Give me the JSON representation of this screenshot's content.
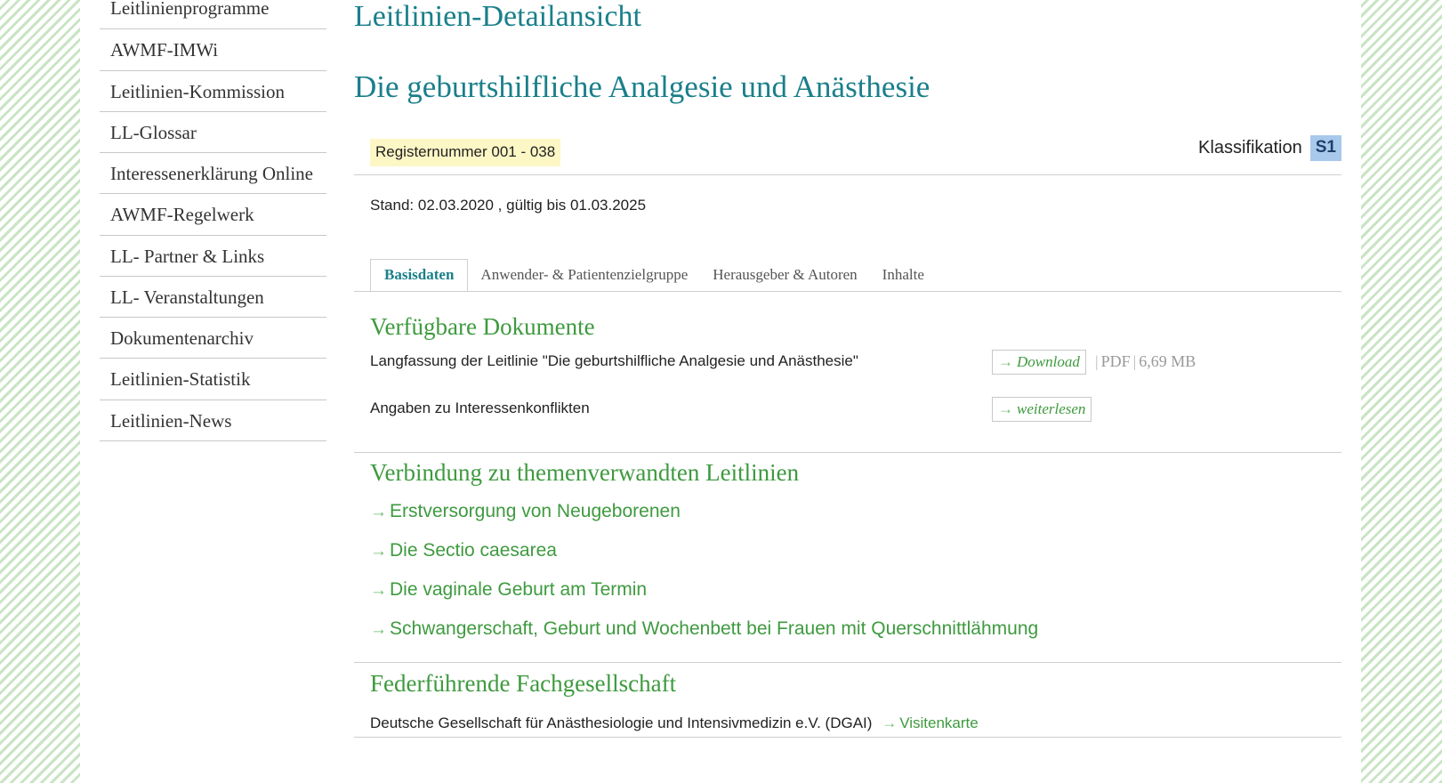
{
  "sidebar": {
    "items": [
      {
        "label": "Leitlinienprogramme"
      },
      {
        "label": "AWMF-IMWi"
      },
      {
        "label": "Leitlinien-Kommission"
      },
      {
        "label": "LL-Glossar"
      },
      {
        "label": "Interessenerklärung Online"
      },
      {
        "label": "AWMF-Regelwerk"
      },
      {
        "label": "LL- Partner & Links"
      },
      {
        "label": "LL- Veranstaltungen"
      },
      {
        "label": "Dokumentenarchiv"
      },
      {
        "label": "Leitlinien-Statistik"
      },
      {
        "label": "Leitlinien-News"
      }
    ]
  },
  "header": {
    "section_title": "Leitlinien-Detailansicht",
    "guideline_title": "Die geburtshilfliche Analgesie und Anästhesie"
  },
  "meta": {
    "register": "Registernummer 001 - 038",
    "classification_label": "Klassifikation",
    "classification_value": "S1",
    "stand": "Stand: 02.03.2020 , gültig bis 01.03.2025"
  },
  "tabs": [
    {
      "label": "Basisdaten",
      "active": true
    },
    {
      "label": "Anwender- & Patientenzielgruppe",
      "active": false
    },
    {
      "label": "Herausgeber & Autoren",
      "active": false
    },
    {
      "label": "Inhalte",
      "active": false
    }
  ],
  "documents": {
    "heading": "Verfügbare Dokumente",
    "items": [
      {
        "label": "Langfassung der Leitlinie \"Die geburtshilfliche Analgesie und Anästhesie\"",
        "button": "Download",
        "arrow": "→",
        "format": "PDF",
        "size": "6,69 MB"
      },
      {
        "label": "Angaben zu Interessenkonflikten",
        "button": "weiterlesen",
        "arrow": "→"
      }
    ]
  },
  "related": {
    "heading": "Verbindung zu themenverwandten Leitlinien",
    "arrow": "→",
    "links": [
      {
        "label": "Erstversorgung von Neugeborenen"
      },
      {
        "label": "Die Sectio caesarea"
      },
      {
        "label": "Die vaginale Geburt am Termin"
      },
      {
        "label": "Schwangerschaft, Geburt und Wochenbett bei Frauen mit Querschnittlähmung"
      }
    ]
  },
  "lead_society": {
    "heading": "Federführende Fachgesellschaft",
    "name": "Deutsche Gesellschaft für Anästhesiologie und Intensivmedizin e.V. (DGAI)",
    "arrow": "→",
    "link": "Visitenkarte"
  },
  "colors": {
    "title_teal": "#1a7f8a",
    "section_green": "#3e9a3f",
    "badge_yellow": "#fdf7c6",
    "class_blue": "#a8c8ec",
    "stripe_green": "#c9e4c4"
  }
}
